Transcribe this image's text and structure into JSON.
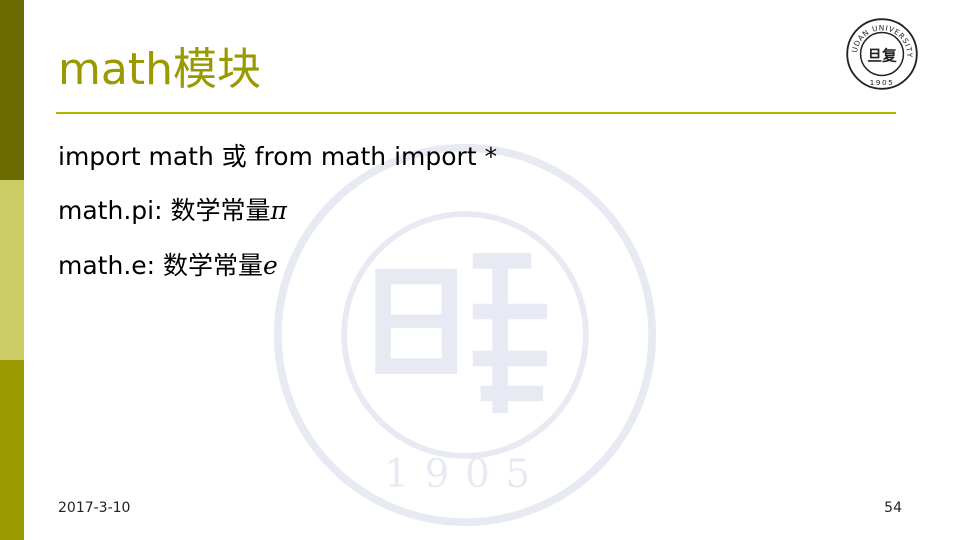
{
  "slide": {
    "title": "math模块",
    "lines": [
      {
        "text": "import math 或 from math import *",
        "symbol": ""
      },
      {
        "text": "math.pi: 数学常量",
        "symbol": "π"
      },
      {
        "text": "math.e: 数学常量",
        "symbol": "e"
      }
    ],
    "date": "2017-3-10",
    "page_number": "54"
  },
  "logo": {
    "arc_text": "FUDAN UNIVERSITY",
    "year": "1905",
    "char": "旦复"
  },
  "colors": {
    "title": "#999900",
    "rule": "#b3b300",
    "sidebar": [
      "#6b6b00",
      "#cccc66",
      "#9a9a00"
    ]
  }
}
